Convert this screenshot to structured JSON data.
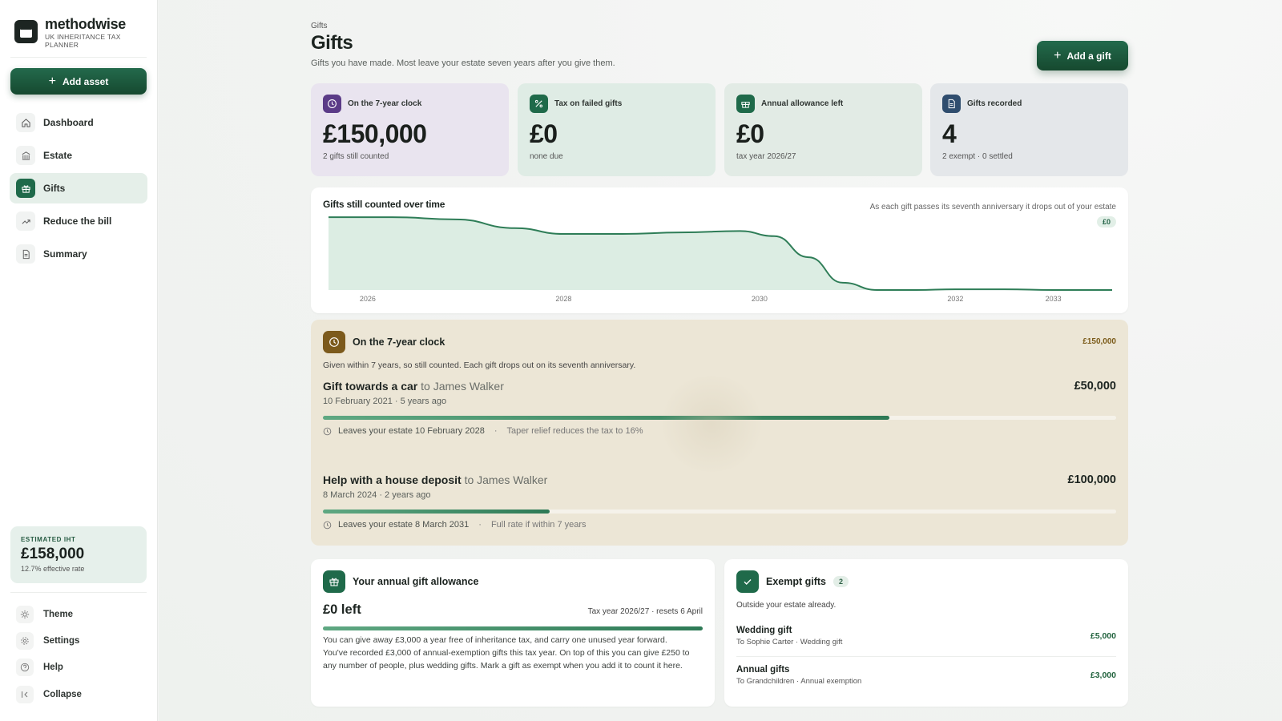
{
  "brand": {
    "name": "methodwise",
    "tagline": "UK INHERITANCE TAX PLANNER"
  },
  "sidebar": {
    "add_asset_label": "Add asset",
    "items": [
      {
        "label": "Dashboard",
        "icon": "home-icon"
      },
      {
        "label": "Estate",
        "icon": "bank-icon"
      },
      {
        "label": "Gifts",
        "icon": "gift-icon",
        "active": true
      },
      {
        "label": "Reduce the bill",
        "icon": "trend-icon"
      },
      {
        "label": "Summary",
        "icon": "document-icon"
      }
    ],
    "estimate": {
      "label": "ESTIMATED IHT",
      "value": "£158,000",
      "rate": "12.7% effective rate"
    },
    "utility": [
      {
        "label": "Theme",
        "icon": "sun-icon"
      },
      {
        "label": "Settings",
        "icon": "gear-icon"
      },
      {
        "label": "Help",
        "icon": "help-icon"
      },
      {
        "label": "Collapse",
        "icon": "collapse-icon"
      }
    ]
  },
  "header": {
    "breadcrumb": "Gifts",
    "title": "Gifts",
    "subtitle": "Gifts you have made. Most leave your estate seven years after you give them.",
    "add_gift_label": "Add a gift"
  },
  "stats": [
    {
      "label": "On the 7-year clock",
      "value": "£150,000",
      "sub": "2 gifts still counted",
      "bg": "#e9e4ef",
      "icon_bg": "#5b3b87",
      "icon": "clock-icon"
    },
    {
      "label": "Tax on failed gifts",
      "value": "£0",
      "sub": "none due",
      "bg": "#dfece5",
      "icon_bg": "#1f6a4a",
      "icon": "percent-icon"
    },
    {
      "label": "Annual allowance left",
      "value": "£0",
      "sub": "tax year 2026/27",
      "bg": "#e2ebe5",
      "icon_bg": "#1f6a4a",
      "icon": "gift-icon"
    },
    {
      "label": "Gifts recorded",
      "value": "4",
      "sub": "2 exempt · 0 settled",
      "bg": "#e4e7ea",
      "icon_bg": "#2f4d6e",
      "icon": "document-icon"
    }
  ],
  "chart": {
    "title": "Gifts still counted over time",
    "note": "As each gift passes its seventh anniversary it drops out of your estate",
    "current_value": "£0"
  },
  "chart_data": {
    "type": "area",
    "title": "Gifts still counted over time",
    "x": [
      2025.6,
      2026.25,
      2026.9,
      2027.5,
      2028.0,
      2028.6,
      2029.2,
      2029.8,
      2030.15,
      2030.5,
      2030.85,
      2031.2,
      2031.6,
      2032.0,
      2032.5,
      2033.0,
      2033.6
    ],
    "values": [
      100,
      100,
      97,
      85,
      77,
      77,
      79,
      81,
      74,
      45,
      10,
      0,
      0,
      1,
      1,
      0,
      0
    ],
    "xlim": [
      2025.6,
      2033.6
    ],
    "x_ticks": [
      2026,
      2028,
      2030,
      2032,
      2033
    ],
    "x_tick_labels": [
      "2026",
      "2028",
      "2030",
      "2032",
      "2033"
    ],
    "ylim": [
      0,
      110
    ],
    "grid": false,
    "legend": "none",
    "color": "#2e7d57",
    "fill": "#dcede3"
  },
  "clock": {
    "title": "On the 7-year clock",
    "total": "£150,000",
    "description": "Given within 7 years, so still counted. Each gift drops out on its seventh anniversary.",
    "gifts": [
      {
        "title": "Gift towards a car",
        "to": "to James Walker",
        "amount": "£50,000",
        "meta": "10 February 2021 · 5 years ago",
        "progress": 0.714,
        "leaves": "Leaves your estate 10 February 2028",
        "note": "Taper relief reduces the tax to 16%"
      },
      {
        "title": "Help with a house deposit",
        "to": "to James Walker",
        "amount": "£100,000",
        "meta": "8 March 2024 · 2 years ago",
        "progress": 0.286,
        "leaves": "Leaves your estate 8 March 2031",
        "note": "Full rate if within 7 years"
      }
    ]
  },
  "allowance": {
    "title": "Your annual gift allowance",
    "left": "£0 left",
    "tax_year": "Tax year 2026/27 · resets 6 April",
    "progress": 1.0,
    "text": "You can give away £3,000 a year free of inheritance tax, and carry one unused year forward. You've recorded £3,000 of annual-exemption gifts this tax year. On top of this you can give £250 to any number of people, plus wedding gifts. Mark a gift as exempt when you add it to count it here."
  },
  "exempt": {
    "title": "Exempt gifts",
    "count": "2",
    "subtitle": "Outside your estate already.",
    "items": [
      {
        "name": "Wedding gift",
        "detail": "To Sophie Carter · Wedding gift",
        "amount": "£5,000"
      },
      {
        "name": "Annual gifts",
        "detail": "To Grandchildren · Annual exemption",
        "amount": "£3,000"
      }
    ]
  }
}
